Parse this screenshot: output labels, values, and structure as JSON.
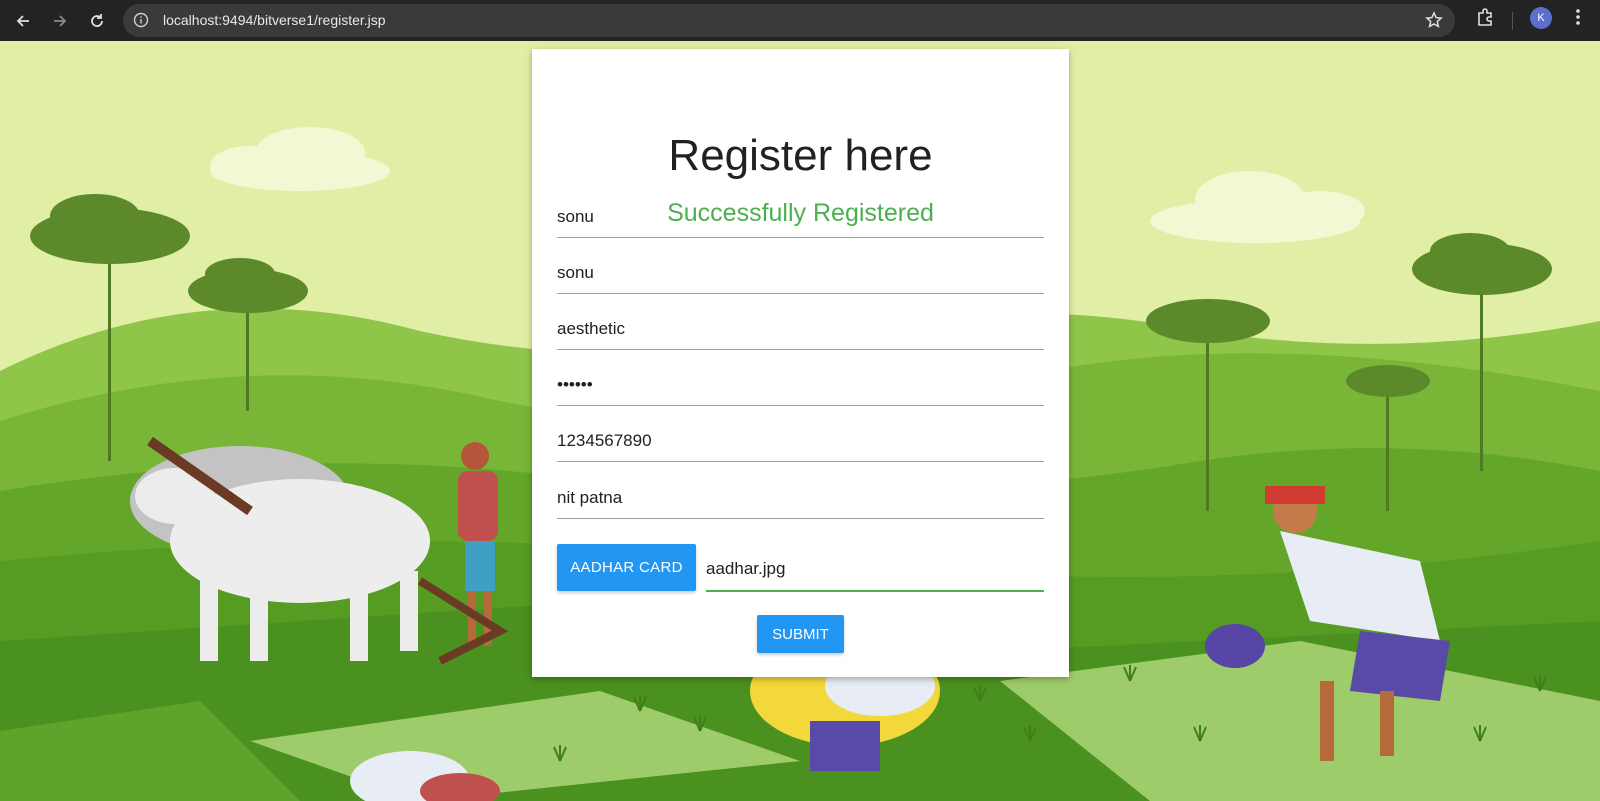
{
  "browser": {
    "url": "localhost:9494/bitverse1/register.jsp",
    "profile_initial": "K"
  },
  "form": {
    "title": "Register here",
    "status_message": "Successfully Registered",
    "fields": [
      "sonu",
      "sonu",
      "aesthetic",
      "••••••",
      "1234567890",
      "nit patna"
    ],
    "file_button_label": "AADHAR CARD",
    "file_name": "aadhar.jpg",
    "submit_label": "SUBMIT"
  },
  "colors": {
    "accent": "#2196f3",
    "success": "#4caf50"
  }
}
